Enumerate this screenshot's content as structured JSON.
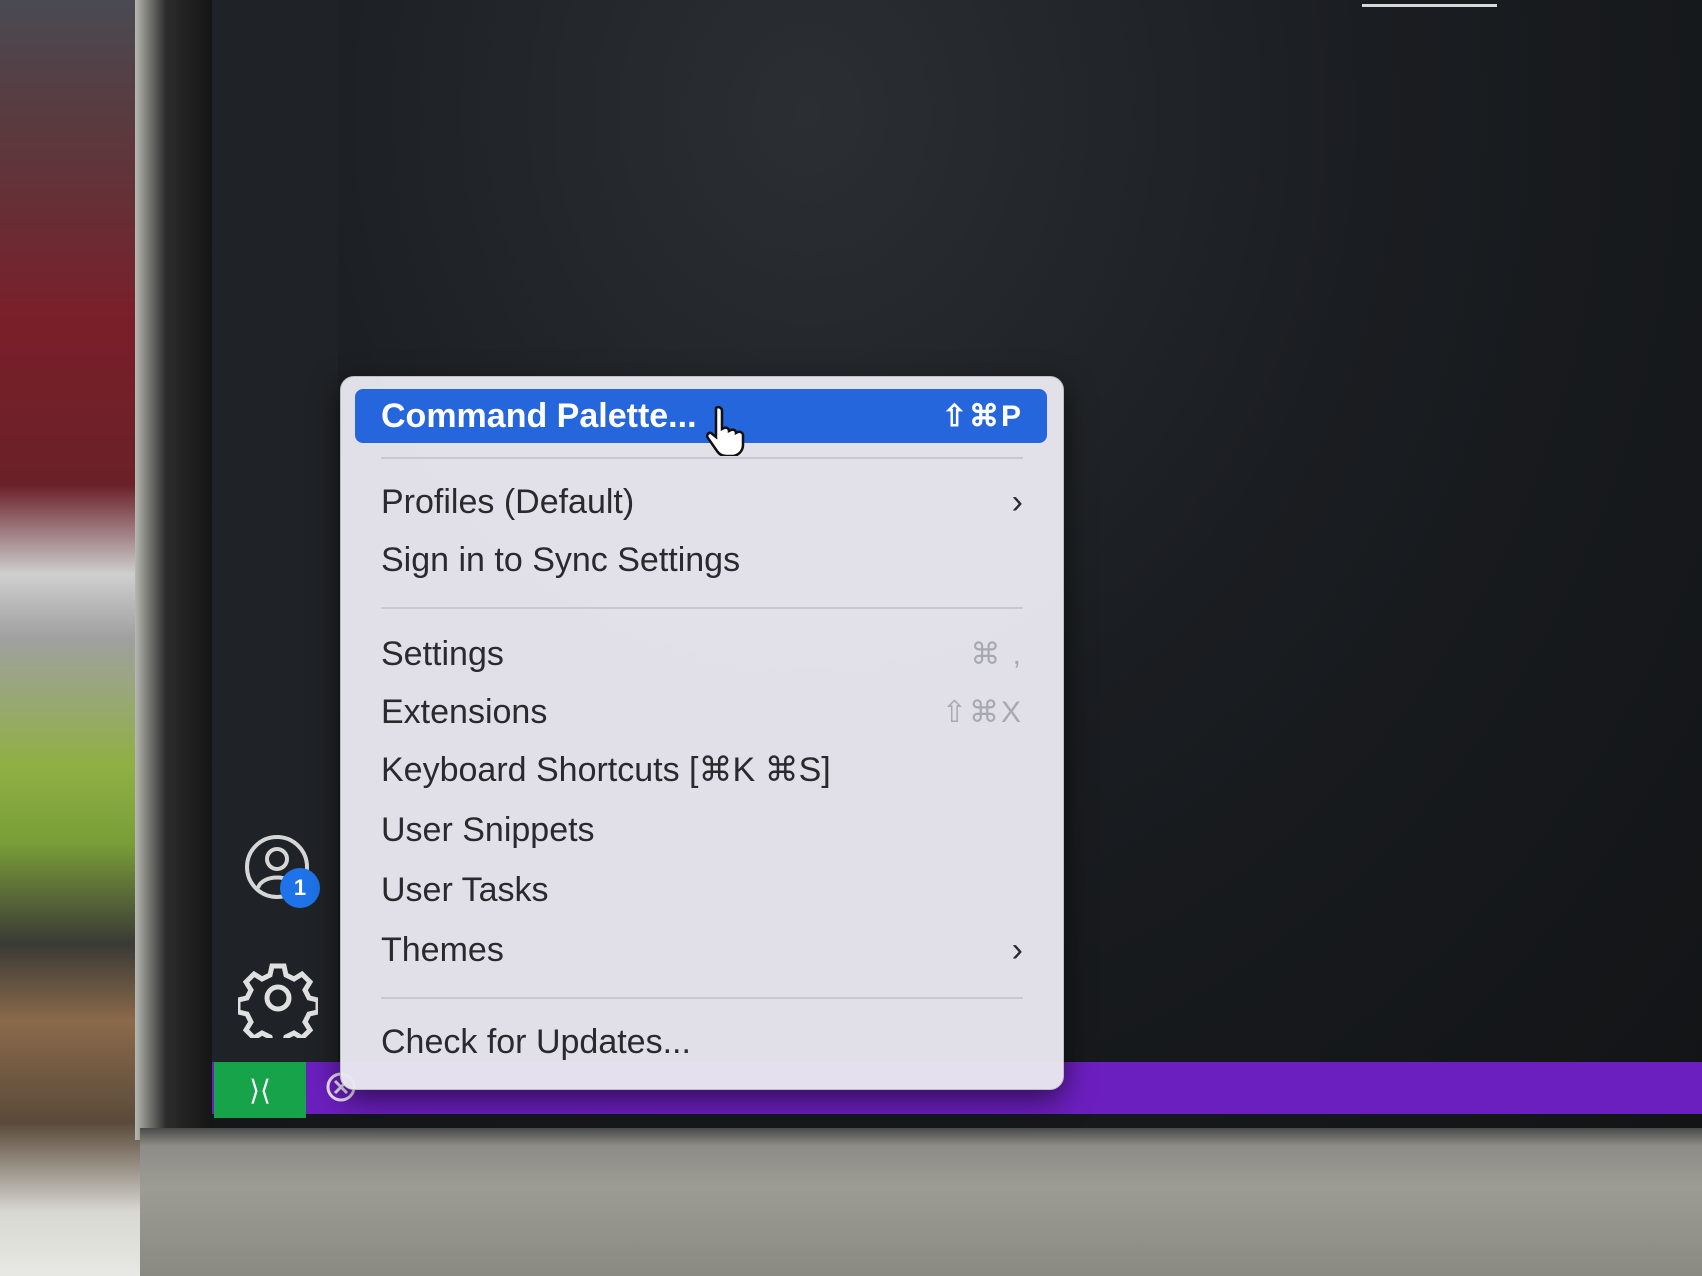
{
  "menu": {
    "items": [
      {
        "label": "Command Palette...",
        "shortcut": "⇧⌘P",
        "active": true
      },
      {
        "label": "Profiles (Default)",
        "submenu": true
      },
      {
        "label": "Sign in to Sync Settings"
      },
      {
        "label": "Settings",
        "shortcut": "⌘ ,"
      },
      {
        "label": "Extensions",
        "shortcut": "⇧⌘X"
      },
      {
        "label": "Keyboard Shortcuts [⌘K ⌘S]"
      },
      {
        "label": "User Snippets"
      },
      {
        "label": "User Tasks"
      },
      {
        "label": "Themes",
        "submenu": true
      },
      {
        "label": "Check for Updates..."
      }
    ],
    "submenu_glyph": "›"
  },
  "activity_bar": {
    "accounts_badge": "1",
    "icons": [
      "account-icon",
      "gear-icon"
    ]
  },
  "status_bar": {
    "remote_glyph": "⟩⟨",
    "accent": "#6c1fbf",
    "remote_color": "#16a34a"
  },
  "colors": {
    "menu_highlight": "#2566dc",
    "badge": "#1e73e8"
  }
}
